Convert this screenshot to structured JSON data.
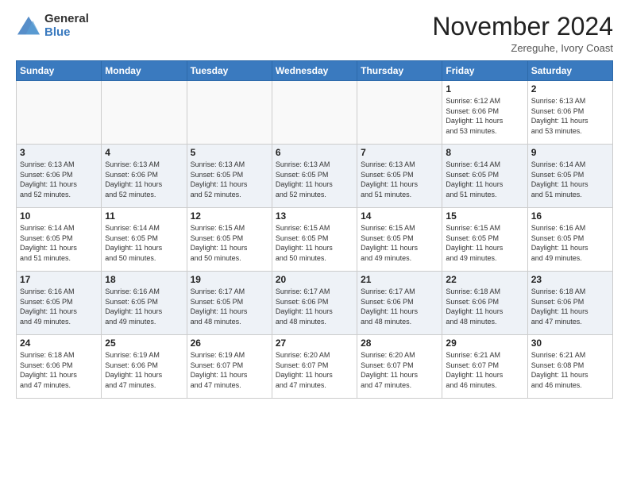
{
  "header": {
    "logo_general": "General",
    "logo_blue": "Blue",
    "month_title": "November 2024",
    "subtitle": "Zereguhe, Ivory Coast"
  },
  "weekdays": [
    "Sunday",
    "Monday",
    "Tuesday",
    "Wednesday",
    "Thursday",
    "Friday",
    "Saturday"
  ],
  "weeks": [
    [
      {
        "day": "",
        "info": ""
      },
      {
        "day": "",
        "info": ""
      },
      {
        "day": "",
        "info": ""
      },
      {
        "day": "",
        "info": ""
      },
      {
        "day": "",
        "info": ""
      },
      {
        "day": "1",
        "info": "Sunrise: 6:12 AM\nSunset: 6:06 PM\nDaylight: 11 hours\nand 53 minutes."
      },
      {
        "day": "2",
        "info": "Sunrise: 6:13 AM\nSunset: 6:06 PM\nDaylight: 11 hours\nand 53 minutes."
      }
    ],
    [
      {
        "day": "3",
        "info": "Sunrise: 6:13 AM\nSunset: 6:06 PM\nDaylight: 11 hours\nand 52 minutes."
      },
      {
        "day": "4",
        "info": "Sunrise: 6:13 AM\nSunset: 6:06 PM\nDaylight: 11 hours\nand 52 minutes."
      },
      {
        "day": "5",
        "info": "Sunrise: 6:13 AM\nSunset: 6:05 PM\nDaylight: 11 hours\nand 52 minutes."
      },
      {
        "day": "6",
        "info": "Sunrise: 6:13 AM\nSunset: 6:05 PM\nDaylight: 11 hours\nand 52 minutes."
      },
      {
        "day": "7",
        "info": "Sunrise: 6:13 AM\nSunset: 6:05 PM\nDaylight: 11 hours\nand 51 minutes."
      },
      {
        "day": "8",
        "info": "Sunrise: 6:14 AM\nSunset: 6:05 PM\nDaylight: 11 hours\nand 51 minutes."
      },
      {
        "day": "9",
        "info": "Sunrise: 6:14 AM\nSunset: 6:05 PM\nDaylight: 11 hours\nand 51 minutes."
      }
    ],
    [
      {
        "day": "10",
        "info": "Sunrise: 6:14 AM\nSunset: 6:05 PM\nDaylight: 11 hours\nand 51 minutes."
      },
      {
        "day": "11",
        "info": "Sunrise: 6:14 AM\nSunset: 6:05 PM\nDaylight: 11 hours\nand 50 minutes."
      },
      {
        "day": "12",
        "info": "Sunrise: 6:15 AM\nSunset: 6:05 PM\nDaylight: 11 hours\nand 50 minutes."
      },
      {
        "day": "13",
        "info": "Sunrise: 6:15 AM\nSunset: 6:05 PM\nDaylight: 11 hours\nand 50 minutes."
      },
      {
        "day": "14",
        "info": "Sunrise: 6:15 AM\nSunset: 6:05 PM\nDaylight: 11 hours\nand 49 minutes."
      },
      {
        "day": "15",
        "info": "Sunrise: 6:15 AM\nSunset: 6:05 PM\nDaylight: 11 hours\nand 49 minutes."
      },
      {
        "day": "16",
        "info": "Sunrise: 6:16 AM\nSunset: 6:05 PM\nDaylight: 11 hours\nand 49 minutes."
      }
    ],
    [
      {
        "day": "17",
        "info": "Sunrise: 6:16 AM\nSunset: 6:05 PM\nDaylight: 11 hours\nand 49 minutes."
      },
      {
        "day": "18",
        "info": "Sunrise: 6:16 AM\nSunset: 6:05 PM\nDaylight: 11 hours\nand 49 minutes."
      },
      {
        "day": "19",
        "info": "Sunrise: 6:17 AM\nSunset: 6:05 PM\nDaylight: 11 hours\nand 48 minutes."
      },
      {
        "day": "20",
        "info": "Sunrise: 6:17 AM\nSunset: 6:06 PM\nDaylight: 11 hours\nand 48 minutes."
      },
      {
        "day": "21",
        "info": "Sunrise: 6:17 AM\nSunset: 6:06 PM\nDaylight: 11 hours\nand 48 minutes."
      },
      {
        "day": "22",
        "info": "Sunrise: 6:18 AM\nSunset: 6:06 PM\nDaylight: 11 hours\nand 48 minutes."
      },
      {
        "day": "23",
        "info": "Sunrise: 6:18 AM\nSunset: 6:06 PM\nDaylight: 11 hours\nand 47 minutes."
      }
    ],
    [
      {
        "day": "24",
        "info": "Sunrise: 6:18 AM\nSunset: 6:06 PM\nDaylight: 11 hours\nand 47 minutes."
      },
      {
        "day": "25",
        "info": "Sunrise: 6:19 AM\nSunset: 6:06 PM\nDaylight: 11 hours\nand 47 minutes."
      },
      {
        "day": "26",
        "info": "Sunrise: 6:19 AM\nSunset: 6:07 PM\nDaylight: 11 hours\nand 47 minutes."
      },
      {
        "day": "27",
        "info": "Sunrise: 6:20 AM\nSunset: 6:07 PM\nDaylight: 11 hours\nand 47 minutes."
      },
      {
        "day": "28",
        "info": "Sunrise: 6:20 AM\nSunset: 6:07 PM\nDaylight: 11 hours\nand 47 minutes."
      },
      {
        "day": "29",
        "info": "Sunrise: 6:21 AM\nSunset: 6:07 PM\nDaylight: 11 hours\nand 46 minutes."
      },
      {
        "day": "30",
        "info": "Sunrise: 6:21 AM\nSunset: 6:08 PM\nDaylight: 11 hours\nand 46 minutes."
      }
    ]
  ]
}
